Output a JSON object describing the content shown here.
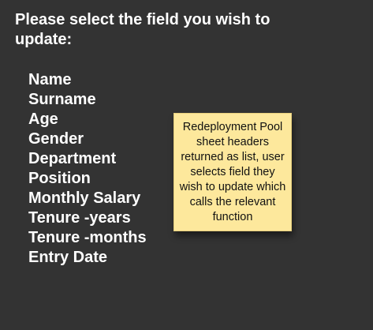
{
  "prompt": {
    "text": "Please select the field you wish to update:"
  },
  "fields": [
    {
      "label": "Name"
    },
    {
      "label": "Surname"
    },
    {
      "label": "Age"
    },
    {
      "label": "Gender"
    },
    {
      "label": "Department"
    },
    {
      "label": "Position"
    },
    {
      "label": "Monthly Salary"
    },
    {
      "label": "Tenure -years"
    },
    {
      "label": "Tenure -months"
    },
    {
      "label": "Entry Date"
    }
  ],
  "note": {
    "text": "Redeployment Pool sheet headers returned as list, user selects field they wish to update which calls the relevant function"
  },
  "colors": {
    "background": "#333333",
    "text": "#ffffff",
    "note_background": "#fde89c"
  }
}
